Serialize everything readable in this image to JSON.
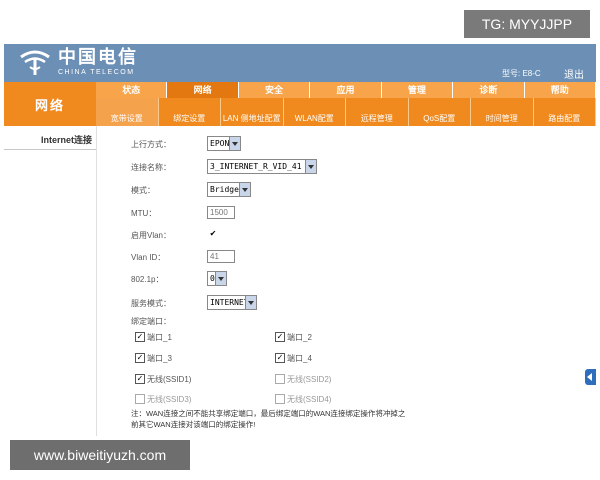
{
  "overlay": {
    "tag": "TG: MYYJJPP",
    "watermark": "www.biweitiyuzh.com"
  },
  "brand": {
    "name_cn": "中国电信",
    "name_en": "CHINA TELECOM"
  },
  "header": {
    "model": "型号: E8-C",
    "logout": "退出"
  },
  "nav_left": "网络",
  "nav_main": [
    "状态",
    "网络",
    "安全",
    "应用",
    "管理",
    "诊断",
    "帮助"
  ],
  "nav_main_active": "网络",
  "nav_sub": [
    "宽带设置",
    "绑定设置",
    "LAN 侧地址配置",
    "WLAN配置",
    "远程管理",
    "QoS配置",
    "时间管理",
    "路由配置"
  ],
  "side": {
    "item": "Internet连接"
  },
  "form": {
    "uplink_label": "上行方式：",
    "uplink_value": "EPON",
    "conn_label": "连接名称：",
    "conn_value": "3_INTERNET_R_VID_41",
    "mode_label": "模式：",
    "mode_value": "Bridge",
    "mtu_label": "MTU：",
    "mtu_value": "1500",
    "vlan_enable_label": "启用Vlan：",
    "vlan_enable_checked": true,
    "vlan_id_label": "Vlan ID：",
    "vlan_id_value": "41",
    "dot1p_label": "802.1p：",
    "dot1p_value": "0",
    "service_label": "服务模式：",
    "service_value": "INTERNET",
    "bind_label": "绑定端口：",
    "ports": [
      {
        "label": "端口_1",
        "checked": true,
        "enabled": true
      },
      {
        "label": "端口_2",
        "checked": true,
        "enabled": true
      },
      {
        "label": "端口_3",
        "checked": true,
        "enabled": true
      },
      {
        "label": "端口_4",
        "checked": true,
        "enabled": true
      },
      {
        "label": "无线(SSID1)",
        "checked": true,
        "enabled": true
      },
      {
        "label": "无线(SSID2)",
        "checked": false,
        "enabled": false
      },
      {
        "label": "无线(SSID3)",
        "checked": false,
        "enabled": false
      },
      {
        "label": "无线(SSID4)",
        "checked": false,
        "enabled": false
      }
    ],
    "note_line1": "注：WAN连接之间不能共享绑定端口，最后绑定端口的WAN连接绑定操作将冲掉之",
    "note_line2": "前其它WAN连接对该端口的绑定操作!"
  }
}
